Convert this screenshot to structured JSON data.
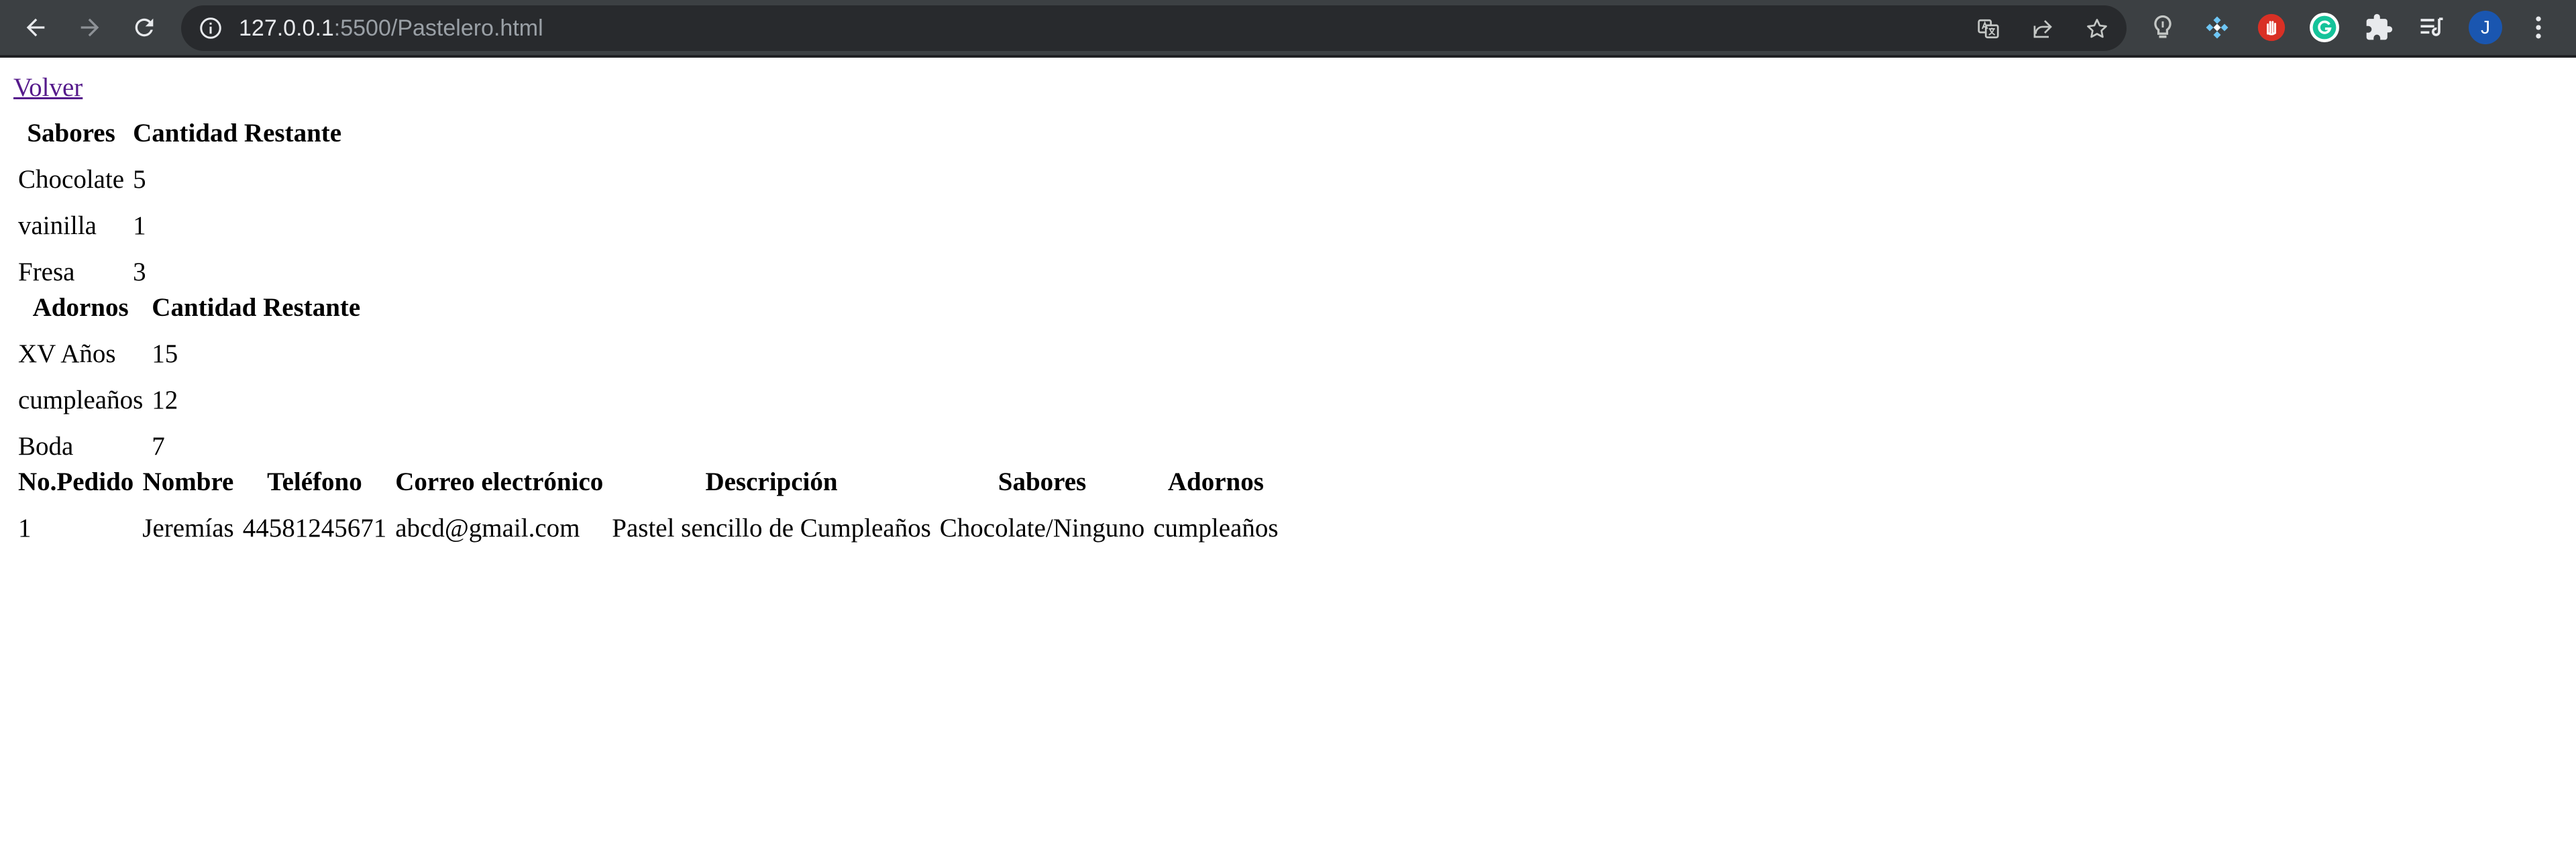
{
  "browser": {
    "url_host": "127.0.0.1",
    "url_rest": ":5500/Pastelero.html",
    "avatar_letter": "J",
    "icons": [
      "back-arrow-icon",
      "forward-arrow-icon",
      "reload-icon",
      "site-info-icon",
      "translate-icon",
      "share-icon",
      "bookmark-star-icon",
      "lightbulb-extension-icon",
      "puzzle-blue-extension-icon",
      "red-hand-extension-icon",
      "grammarly-icon",
      "extensions-puzzle-icon",
      "reading-list-icon",
      "kebab-menu-icon"
    ],
    "colors": {
      "toolbar": "#3c4043",
      "omnibox": "#282a2d",
      "grammarly": "#15c39a",
      "red_ext": "#d93025",
      "avatar": "#1a56b0"
    }
  },
  "page": {
    "back_link": "Volver",
    "link_color": "#551a8b",
    "sabores_table": {
      "headers": [
        "Sabores",
        "Cantidad Restante"
      ],
      "rows": [
        [
          "Chocolate",
          "5"
        ],
        [
          "vainilla",
          "1"
        ],
        [
          "Fresa",
          "3"
        ]
      ]
    },
    "adornos_table": {
      "headers": [
        "Adornos",
        "Cantidad Restante"
      ],
      "rows": [
        [
          "XV Años",
          "15"
        ],
        [
          "cumpleaños",
          "12"
        ],
        [
          "Boda",
          "7"
        ]
      ]
    },
    "pedidos_table": {
      "headers": [
        "No.Pedido",
        "Nombre",
        "Teléfono",
        "Correo electrónico",
        "Descripción",
        "Sabores",
        "Adornos"
      ],
      "rows": [
        [
          "1",
          "Jeremías",
          "44581245671",
          "abcd@gmail.com",
          "Pastel sencillo de Cumpleaños",
          "Chocolate/Ninguno",
          "cumpleaños"
        ]
      ]
    }
  }
}
